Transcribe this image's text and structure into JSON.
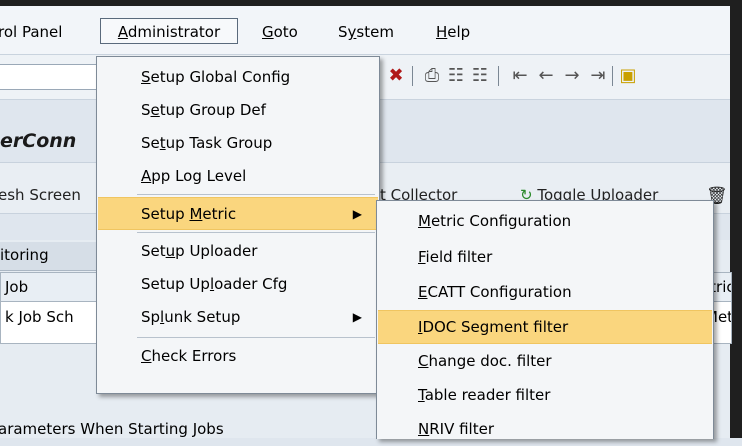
{
  "menubar": {
    "items": [
      {
        "pre": "rol Panel",
        "ul": "",
        "post": ""
      },
      {
        "pre": "",
        "ul": "A",
        "post": "dministrator"
      },
      {
        "pre": "",
        "ul": "G",
        "post": "oto"
      },
      {
        "pre": "S",
        "ul": "y",
        "post": "stem"
      },
      {
        "pre": "",
        "ul": "H",
        "post": "elp"
      }
    ]
  },
  "window": {
    "title_fragment": "erConn"
  },
  "app_toolbar": {
    "refresh_label": "esh Screen",
    "collector_label": "t Collector",
    "uploader_label": "Toggle Uploader"
  },
  "content": {
    "tab_label": "itoring",
    "left_col_header": "Job",
    "left_col_value": "k Job Sch",
    "right_col_header": "Metric",
    "right_col_value": "Is Met",
    "bottom_text": "arameters When Starting Jobs"
  },
  "admin_menu": {
    "items": [
      {
        "pre": "",
        "ul": "S",
        "post": "etup Global Config"
      },
      {
        "pre": "S",
        "ul": "e",
        "post": "tup Group Def"
      },
      {
        "pre": "Se",
        "ul": "t",
        "post": "up Task Group"
      },
      {
        "pre": "",
        "ul": "A",
        "post": "pp Log Level"
      },
      {
        "pre": "Setup ",
        "ul": "M",
        "post": "etric"
      },
      {
        "pre": "Set",
        "ul": "u",
        "post": "p Uploader"
      },
      {
        "pre": "Setup Up",
        "ul": "l",
        "post": "oader Cfg"
      },
      {
        "pre": "Sp",
        "ul": "l",
        "post": "unk Setup"
      },
      {
        "pre": "",
        "ul": "C",
        "post": "heck Errors"
      }
    ]
  },
  "metric_submenu": {
    "items": [
      {
        "pre": "",
        "ul": "M",
        "post": "etric Configuration"
      },
      {
        "pre": "",
        "ul": "F",
        "post": "ield filter"
      },
      {
        "pre": "",
        "ul": "E",
        "post": "CATT Configuration"
      },
      {
        "pre": "",
        "ul": "I",
        "post": "DOC Segment filter"
      },
      {
        "pre": "",
        "ul": "C",
        "post": "hange doc. filter"
      },
      {
        "pre": "",
        "ul": "T",
        "post": "able reader filter"
      },
      {
        "pre": "",
        "ul": "N",
        "post": "RIV filter"
      }
    ]
  },
  "colors": {
    "highlight": "#fad67e",
    "menu_bg": "#f4f6f8",
    "frame": "#1f1f1f"
  }
}
